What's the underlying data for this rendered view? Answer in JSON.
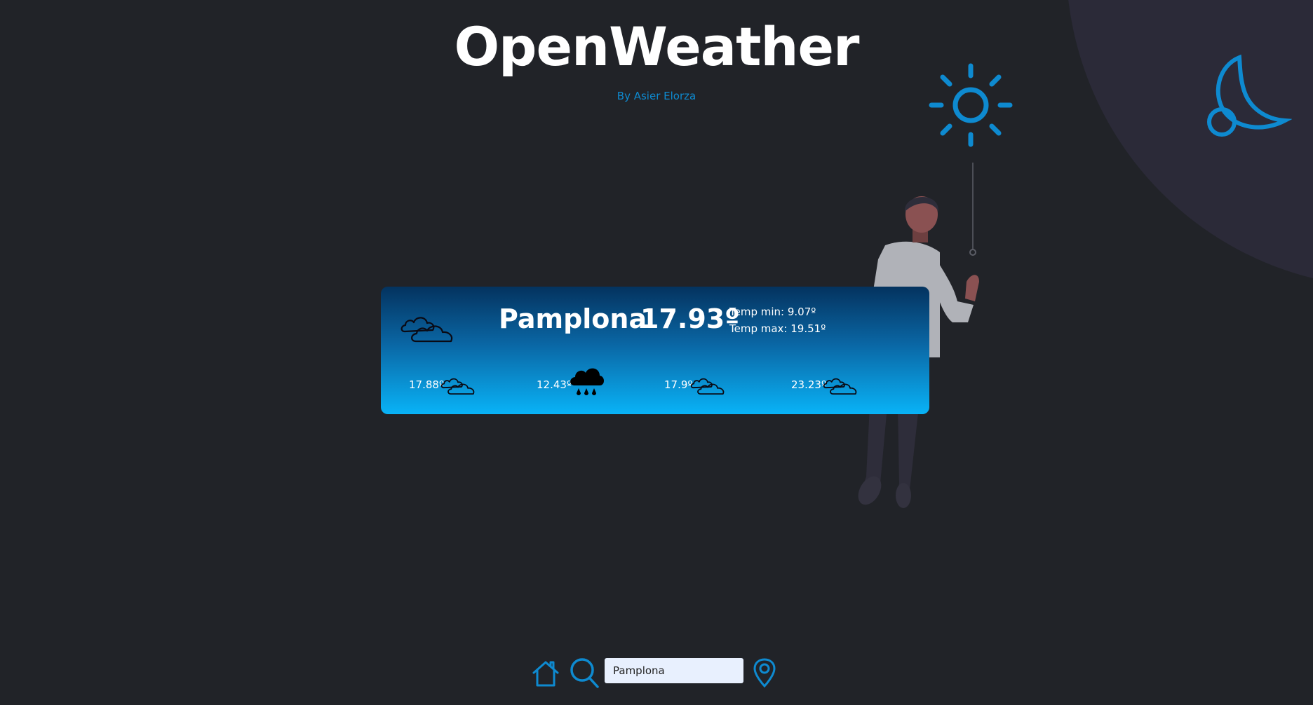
{
  "header": {
    "title": "OpenWeather",
    "subtitle": "By Asier Elorza"
  },
  "icons": {
    "theme_light": "sun-icon",
    "theme_dark": "moon-icon",
    "home": "home-icon",
    "search": "search-icon",
    "location": "location-pin-icon"
  },
  "current": {
    "city": "Pamplona",
    "temp": "17.93º",
    "temp_min_label": "Temp min: 9.07º",
    "temp_max_label": "Temp max: 19.51º",
    "icon": "cloud-icon"
  },
  "forecast": [
    {
      "temp": "17.88º",
      "icon": "cloud-icon"
    },
    {
      "temp": "12.43º",
      "icon": "rain-cloud-icon"
    },
    {
      "temp": "17.9º",
      "icon": "cloud-icon"
    },
    {
      "temp": "23.23º",
      "icon": "cloud-icon"
    }
  ],
  "search": {
    "value": "Pamplona"
  },
  "colors": {
    "background": "#212328",
    "accent": "#0e8ad0",
    "circle": "#2b2a38",
    "card_top": "#04335f",
    "card_bottom": "#09b3f7"
  }
}
